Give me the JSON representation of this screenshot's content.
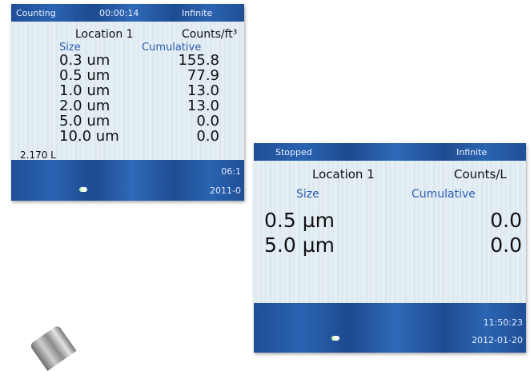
{
  "screen1": {
    "status": "Counting",
    "timer": "00:00:14",
    "mode": "Infinite",
    "location": "Location 1",
    "units": "Counts/ft³",
    "col_size": "Size",
    "col_cumulative": "Cumulative",
    "rows": [
      {
        "size": "0.3 um",
        "value": "155.8"
      },
      {
        "size": "0.5 um",
        "value": "77.9"
      },
      {
        "size": "1.0 um",
        "value": "13.0"
      },
      {
        "size": "2.0 um",
        "value": "13.0"
      },
      {
        "size": "5.0 um",
        "value": "0.0"
      },
      {
        "size": "10.0 um",
        "value": "0.0"
      }
    ],
    "volume": "2.170 L",
    "time_partial": "06:1",
    "date_partial": "2011-0"
  },
  "screen2": {
    "status": "Stopped",
    "mode": "Infinite",
    "location": "Location 1",
    "units": "Counts/L",
    "col_size": "Size",
    "col_cumulative": "Cumulative",
    "rows": [
      {
        "size": "0.5 µm",
        "value": "0.0"
      },
      {
        "size": "5.0 µm",
        "value": "0.0"
      }
    ],
    "time": "11:50:23",
    "date": "2012-01-20"
  },
  "icons": {
    "status_led": "led-icon"
  }
}
